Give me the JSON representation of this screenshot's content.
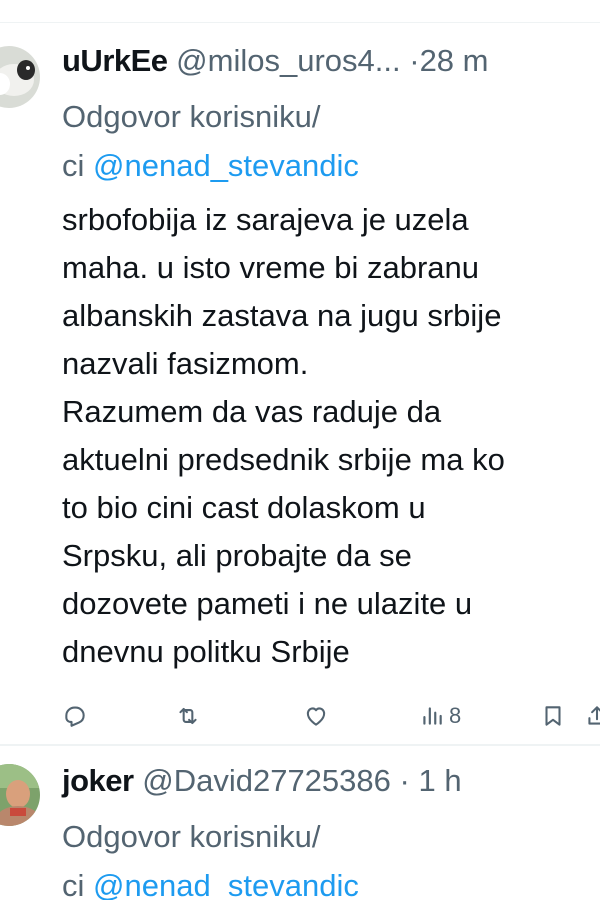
{
  "tweets": [
    {
      "display_name": "uUrkEe",
      "handle": "@milos_uros4...",
      "separator": "·",
      "time": "28 m",
      "reply_prefix": "Odgovor korisniku/",
      "reply_prefix2": "ci",
      "reply_mention": "@nenad_stevandic",
      "text_lines": [
        "srbofobija iz sarajeva je uzela",
        "maha. u isto vreme bi zabranu",
        "albanskih zastava na jugu srbije",
        "nazvali fasizmom.",
        "Razumem da vas raduje da",
        "aktuelni predsednik srbije ma ko",
        "to bio cini cast dolaskom u",
        "Srpsku, ali probajte da se",
        "dozovete pameti i ne ulazite u",
        "dnevnu politku Srbije"
      ],
      "actions": {
        "reply_icon": "reply-icon",
        "retweet_icon": "retweet-icon",
        "like_icon": "heart-icon",
        "views_icon": "views-icon",
        "views_count": "8",
        "bookmark_icon": "bookmark-icon",
        "share_icon": "share-icon"
      }
    },
    {
      "display_name": "joker",
      "handle": "@David27725386",
      "separator": "·",
      "time": "1 h",
      "reply_prefix": "Odgovor korisniku/",
      "reply_prefix2": "ci",
      "reply_mention": "@nenad_stevandic"
    }
  ],
  "colors": {
    "text": "#0f1419",
    "secondary": "#536471",
    "link": "#1d9bf0",
    "divider": "#eff3f4"
  }
}
